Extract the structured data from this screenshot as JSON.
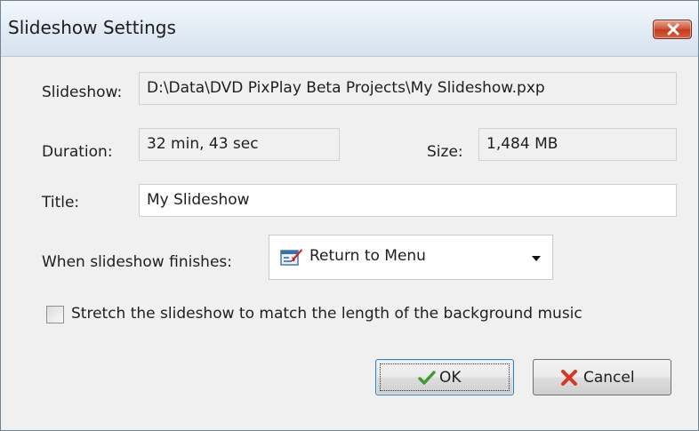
{
  "window": {
    "title": "Slideshow Settings",
    "close_icon": "close-icon"
  },
  "form": {
    "slideshow": {
      "label": "Slideshow:",
      "value": "D:\\Data\\DVD PixPlay Beta Projects\\My Slideshow.pxp"
    },
    "duration": {
      "label": "Duration:",
      "value": "32 min, 43 sec"
    },
    "size": {
      "label": "Size:",
      "value": "1,484 MB"
    },
    "title": {
      "label": "Title:",
      "value": "My Slideshow"
    },
    "finish_action": {
      "label": "When slideshow finishes:",
      "selected": "Return to Menu",
      "icon": "return-to-menu-icon"
    },
    "stretch": {
      "label": "Stretch the slideshow to match the length of the background music",
      "checked": false
    }
  },
  "buttons": {
    "ok": {
      "label": "OK",
      "icon": "checkmark-icon"
    },
    "cancel": {
      "label": "Cancel",
      "icon": "x-icon"
    }
  },
  "colors": {
    "dialog_bg": "#f0f0f0",
    "titlebar_bg": "#dfe9f4",
    "close_red": "#c9452a",
    "ok_green": "#3d9a2b",
    "cancel_red": "#d33a1e"
  }
}
